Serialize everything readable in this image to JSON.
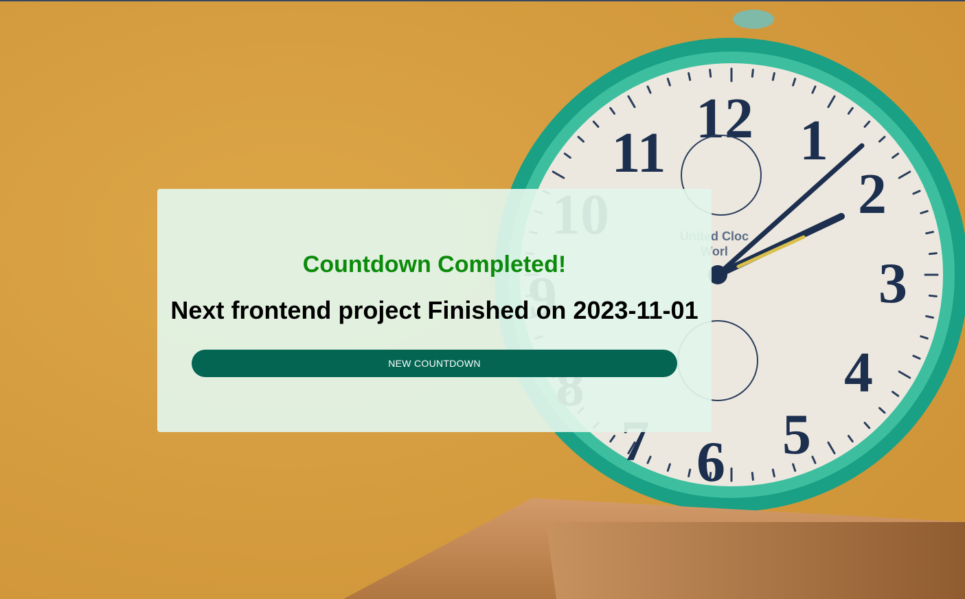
{
  "background": {
    "description_icon": "alarm-clock-photo",
    "colors": {
      "wall": "#d79f3f",
      "clock_rim": "#1fa88a",
      "clock_face": "#ece8df",
      "numerals": "#1d2f4f",
      "box": "#c48a5a"
    },
    "clock": {
      "brand_line1": "United Cloc",
      "brand_line2": "Worl",
      "numerals": [
        "12",
        "1",
        "2",
        "3",
        "4",
        "5",
        "6",
        "7",
        "8",
        "9",
        "10",
        "11"
      ]
    }
  },
  "card": {
    "status_title": "Countdown Completed!",
    "finished_text": "Next frontend project Finished on 2023-11-01",
    "new_countdown_label": "NEW COUNTDOWN",
    "colors": {
      "status": "#0b8a0b",
      "button": "#046553"
    }
  }
}
